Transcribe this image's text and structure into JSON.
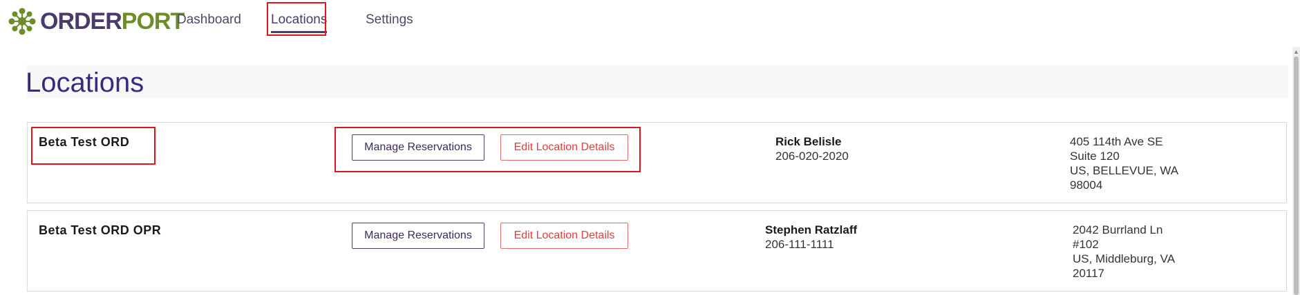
{
  "app": {
    "logo_part1": "ORDER",
    "logo_part2": "PORT"
  },
  "nav": {
    "items": [
      {
        "label": "Dashboard"
      },
      {
        "label": "Locations",
        "active": true
      },
      {
        "label": "Settings"
      }
    ]
  },
  "page": {
    "title": "Locations"
  },
  "locations": [
    {
      "name": "Beta Test ORD",
      "manage_label": "Manage Reservations",
      "edit_label": "Edit Location Details",
      "contact_name": "Rick Belisle",
      "contact_phone": "206-020-2020",
      "address": [
        "405 114th Ave SE",
        "Suite 120",
        "US, BELLEVUE, WA",
        "98004"
      ]
    },
    {
      "name": "Beta Test ORD OPR",
      "manage_label": "Manage Reservations",
      "edit_label": "Edit Location Details",
      "contact_name": "Stephen Ratzlaff",
      "contact_phone": "206-111-1111",
      "address": [
        "2042 Burrland Ln",
        "#102",
        "US, Middleburg, VA",
        "20117"
      ]
    }
  ],
  "colors": {
    "brand_purple": "#4a3b6b",
    "brand_green": "#6d8c2a",
    "title_purple": "#3b2a7a",
    "edit_red": "#e03c3c",
    "highlight_red": "#e0141e"
  },
  "icons": {
    "logo": "flower-logo-icon",
    "scroll_up": "scroll-up-arrow-icon"
  }
}
